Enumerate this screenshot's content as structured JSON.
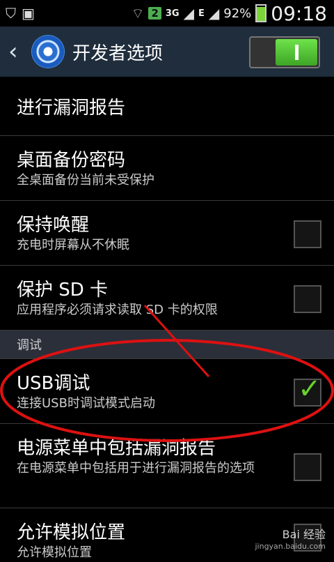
{
  "statusbar": {
    "notify_badge": "2",
    "network_3g": "3G",
    "network_e": "E",
    "battery_percent": "92%",
    "time": "09:18"
  },
  "header": {
    "title": "开发者选项",
    "toggle_on": true
  },
  "items": [
    {
      "title": "进行漏洞报告"
    },
    {
      "title": "桌面备份密码",
      "subtitle": "全桌面备份当前未受保护"
    },
    {
      "title": "保持唤醒",
      "subtitle": "充电时屏幕从不休眠",
      "checked": false
    },
    {
      "title": "保护 SD 卡",
      "subtitle": "应用程序必须请求读取 SD 卡的权限",
      "checked": false
    },
    {
      "section": "调试"
    },
    {
      "title": "USB调试",
      "subtitle": "连接USB时调试模式启动",
      "checked": true
    },
    {
      "title": "电源菜单中包括漏洞报告",
      "subtitle": "在电源菜单中包括用于进行漏洞报告的选项",
      "checked": false
    },
    {
      "title": "允许模拟位置",
      "subtitle": "允许模拟位置",
      "checked": false
    }
  ],
  "watermark": {
    "brand": "Bai 经验",
    "url": "jingyan.baidu.com"
  }
}
